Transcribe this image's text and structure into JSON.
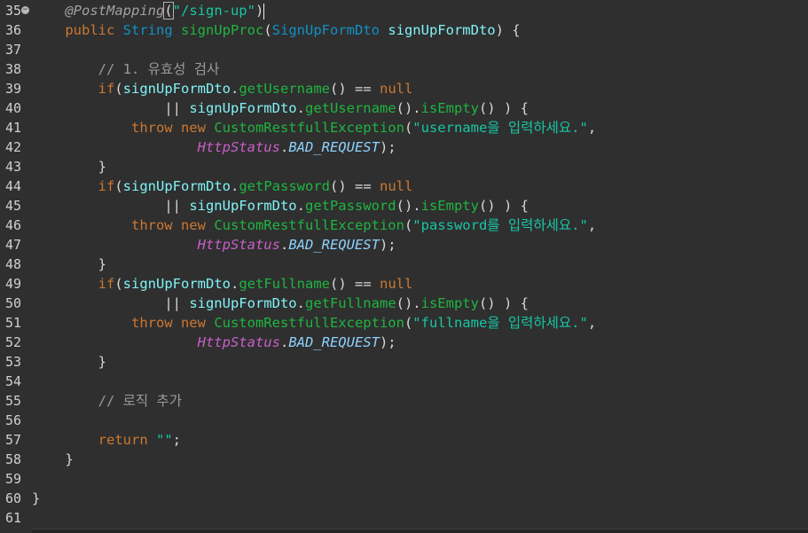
{
  "colors": {
    "background": "#2f2f2f",
    "default": "#d8d8d8",
    "keyword": "#cc7832",
    "type": "#1290c3",
    "method": "#1eb540",
    "field": "#80f2f6",
    "string": "#17c6a3",
    "comment": "#9a9a9a",
    "annotation": "#a0a0a0",
    "static": "#b080ff",
    "constant": "#8dd3ff",
    "typeItalic": "#c85fc8"
  },
  "lines": [
    {
      "n": "35",
      "fold": true,
      "tokens": [
        {
          "t": "    ",
          "c": "default"
        },
        {
          "t": "@PostMapping",
          "c": "annotation",
          "i": true
        },
        {
          "t": "(",
          "c": "default",
          "box": true
        },
        {
          "t": "\"/sign-up\"",
          "c": "string"
        },
        {
          "t": ")",
          "c": "default"
        },
        {
          "cursor": true
        }
      ]
    },
    {
      "n": "36",
      "tokens": [
        {
          "t": "    ",
          "c": "default"
        },
        {
          "t": "public ",
          "c": "keyword"
        },
        {
          "t": "String ",
          "c": "type"
        },
        {
          "t": "signUpProc",
          "c": "method"
        },
        {
          "t": "(",
          "c": "default"
        },
        {
          "t": "SignUpFormDto ",
          "c": "type"
        },
        {
          "t": "signUpFormDto",
          "c": "field"
        },
        {
          "t": ") {",
          "c": "default"
        }
      ]
    },
    {
      "n": "37",
      "tokens": []
    },
    {
      "n": "38",
      "tokens": [
        {
          "t": "        ",
          "c": "default"
        },
        {
          "t": "// 1. 유효성 검사",
          "c": "comment"
        }
      ]
    },
    {
      "n": "39",
      "tokens": [
        {
          "t": "        ",
          "c": "default"
        },
        {
          "t": "if",
          "c": "keyword"
        },
        {
          "t": "(",
          "c": "default"
        },
        {
          "t": "signUpFormDto",
          "c": "field"
        },
        {
          "t": ".",
          "c": "default"
        },
        {
          "t": "getUsername",
          "c": "method"
        },
        {
          "t": "() == ",
          "c": "default"
        },
        {
          "t": "null",
          "c": "keyword"
        }
      ]
    },
    {
      "n": "40",
      "tokens": [
        {
          "t": "                ",
          "c": "default"
        },
        {
          "t": "|| ",
          "c": "default"
        },
        {
          "t": "signUpFormDto",
          "c": "field"
        },
        {
          "t": ".",
          "c": "default"
        },
        {
          "t": "getUsername",
          "c": "method"
        },
        {
          "t": "().",
          "c": "default"
        },
        {
          "t": "isEmpty",
          "c": "method"
        },
        {
          "t": "() ) {",
          "c": "default"
        }
      ]
    },
    {
      "n": "41",
      "tokens": [
        {
          "t": "            ",
          "c": "default"
        },
        {
          "t": "throw new ",
          "c": "keyword"
        },
        {
          "t": "CustomRestfullException",
          "c": "method"
        },
        {
          "t": "(",
          "c": "default"
        },
        {
          "t": "\"username을 입력하세요.\"",
          "c": "string"
        },
        {
          "t": ",",
          "c": "default"
        }
      ]
    },
    {
      "n": "42",
      "tokens": [
        {
          "t": "                    ",
          "c": "default"
        },
        {
          "t": "HttpStatus",
          "c": "typeItalic",
          "i": true
        },
        {
          "t": ".",
          "c": "default"
        },
        {
          "t": "BAD_REQUEST",
          "c": "constant",
          "i": true
        },
        {
          "t": ");",
          "c": "default"
        }
      ]
    },
    {
      "n": "43",
      "tokens": [
        {
          "t": "        }",
          "c": "default"
        }
      ]
    },
    {
      "n": "44",
      "tokens": [
        {
          "t": "        ",
          "c": "default"
        },
        {
          "t": "if",
          "c": "keyword"
        },
        {
          "t": "(",
          "c": "default"
        },
        {
          "t": "signUpFormDto",
          "c": "field"
        },
        {
          "t": ".",
          "c": "default"
        },
        {
          "t": "getPassword",
          "c": "method"
        },
        {
          "t": "() == ",
          "c": "default"
        },
        {
          "t": "null",
          "c": "keyword"
        }
      ]
    },
    {
      "n": "45",
      "tokens": [
        {
          "t": "                ",
          "c": "default"
        },
        {
          "t": "|| ",
          "c": "default"
        },
        {
          "t": "signUpFormDto",
          "c": "field"
        },
        {
          "t": ".",
          "c": "default"
        },
        {
          "t": "getPassword",
          "c": "method"
        },
        {
          "t": "().",
          "c": "default"
        },
        {
          "t": "isEmpty",
          "c": "method"
        },
        {
          "t": "() ) {",
          "c": "default"
        }
      ]
    },
    {
      "n": "46",
      "tokens": [
        {
          "t": "            ",
          "c": "default"
        },
        {
          "t": "throw new ",
          "c": "keyword"
        },
        {
          "t": "CustomRestfullException",
          "c": "method"
        },
        {
          "t": "(",
          "c": "default"
        },
        {
          "t": "\"password를 입력하세요.\"",
          "c": "string"
        },
        {
          "t": ",",
          "c": "default"
        }
      ]
    },
    {
      "n": "47",
      "tokens": [
        {
          "t": "                    ",
          "c": "default"
        },
        {
          "t": "HttpStatus",
          "c": "typeItalic",
          "i": true
        },
        {
          "t": ".",
          "c": "default"
        },
        {
          "t": "BAD_REQUEST",
          "c": "constant",
          "i": true
        },
        {
          "t": ");",
          "c": "default"
        }
      ]
    },
    {
      "n": "48",
      "tokens": [
        {
          "t": "        }",
          "c": "default"
        }
      ]
    },
    {
      "n": "49",
      "tokens": [
        {
          "t": "        ",
          "c": "default"
        },
        {
          "t": "if",
          "c": "keyword"
        },
        {
          "t": "(",
          "c": "default"
        },
        {
          "t": "signUpFormDto",
          "c": "field"
        },
        {
          "t": ".",
          "c": "default"
        },
        {
          "t": "getFullname",
          "c": "method"
        },
        {
          "t": "() == ",
          "c": "default"
        },
        {
          "t": "null",
          "c": "keyword"
        }
      ]
    },
    {
      "n": "50",
      "tokens": [
        {
          "t": "                ",
          "c": "default"
        },
        {
          "t": "|| ",
          "c": "default"
        },
        {
          "t": "signUpFormDto",
          "c": "field"
        },
        {
          "t": ".",
          "c": "default"
        },
        {
          "t": "getFullname",
          "c": "method"
        },
        {
          "t": "().",
          "c": "default"
        },
        {
          "t": "isEmpty",
          "c": "method"
        },
        {
          "t": "() ) {",
          "c": "default"
        }
      ]
    },
    {
      "n": "51",
      "tokens": [
        {
          "t": "            ",
          "c": "default"
        },
        {
          "t": "throw new ",
          "c": "keyword"
        },
        {
          "t": "CustomRestfullException",
          "c": "method"
        },
        {
          "t": "(",
          "c": "default"
        },
        {
          "t": "\"fullname을 입력하세요.\"",
          "c": "string"
        },
        {
          "t": ",",
          "c": "default"
        }
      ]
    },
    {
      "n": "52",
      "tokens": [
        {
          "t": "                    ",
          "c": "default"
        },
        {
          "t": "HttpStatus",
          "c": "typeItalic",
          "i": true
        },
        {
          "t": ".",
          "c": "default"
        },
        {
          "t": "BAD_REQUEST",
          "c": "constant",
          "i": true
        },
        {
          "t": ");",
          "c": "default"
        }
      ]
    },
    {
      "n": "53",
      "tokens": [
        {
          "t": "        }",
          "c": "default"
        }
      ]
    },
    {
      "n": "54",
      "tokens": []
    },
    {
      "n": "55",
      "tokens": [
        {
          "t": "        ",
          "c": "default"
        },
        {
          "t": "// 로직 추가",
          "c": "comment"
        }
      ]
    },
    {
      "n": "56",
      "tokens": []
    },
    {
      "n": "57",
      "tokens": [
        {
          "t": "        ",
          "c": "default"
        },
        {
          "t": "return ",
          "c": "keyword"
        },
        {
          "t": "\"\"",
          "c": "string"
        },
        {
          "t": ";",
          "c": "default"
        }
      ]
    },
    {
      "n": "58",
      "tokens": [
        {
          "t": "    }",
          "c": "default"
        }
      ]
    },
    {
      "n": "59",
      "tokens": []
    },
    {
      "n": "60",
      "tokens": [
        {
          "t": "}",
          "c": "default"
        }
      ]
    },
    {
      "n": "61",
      "tokens": []
    }
  ]
}
